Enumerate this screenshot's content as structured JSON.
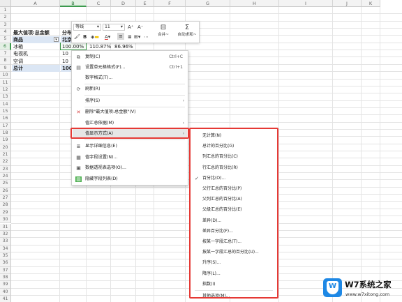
{
  "columns": [
    "A",
    "B",
    "C",
    "D",
    "E",
    "F",
    "G",
    "H",
    "I",
    "J",
    "K"
  ],
  "rows": [
    "1",
    "2",
    "3",
    "4",
    "5",
    "6",
    "7",
    "8",
    "9",
    "10",
    "11",
    "12",
    "13",
    "14",
    "15",
    "16",
    "17",
    "18",
    "19",
    "20",
    "21",
    "22",
    "23",
    "24",
    "25",
    "26",
    "27",
    "28",
    "29",
    "30",
    "31",
    "32",
    "33",
    "34",
    "35",
    "36",
    "37",
    "38",
    "39",
    "40",
    "41"
  ],
  "pivot": {
    "title": "最大值项:总金额",
    "title_right": "分布",
    "row_header": "商品",
    "col_header_partial": "北京",
    "items": [
      {
        "name": "冰箱",
        "b": "100.00%",
        "c": "110.87%",
        "d": "86.96%"
      },
      {
        "name": "电视机",
        "b": "10",
        "c": "",
        "d": ""
      },
      {
        "name": "空调",
        "b": "10",
        "c": "",
        "d": ""
      }
    ],
    "total_label": "总计",
    "total_b": "100"
  },
  "mini_toolbar": {
    "font_name": "等线",
    "font_size": "11",
    "grow_font": "A⁺",
    "shrink_font": "A⁻",
    "merge_label": "合并~",
    "autosum_label": "自动求和~",
    "bold": "B"
  },
  "context_menu": {
    "items": [
      {
        "label": "复制(C)",
        "shortcut": "Ctrl+C",
        "icon": "copy-icon"
      },
      {
        "label": "设置单元格格式(F)...",
        "shortcut": "Ctrl+1",
        "icon": "format-cells-icon"
      },
      {
        "label": "数字格式(T)...",
        "shortcut": "",
        "icon": ""
      },
      {
        "label": "刷新(R)",
        "shortcut": "",
        "icon": "refresh-icon"
      },
      {
        "label": "排序(S)",
        "shortcut": "",
        "icon": ""
      },
      {
        "label": "删除\"最大值项:总金额\"(V)",
        "shortcut": "",
        "icon": "delete-icon"
      },
      {
        "label": "值汇总依据(M)",
        "shortcut": "",
        "icon": ""
      },
      {
        "label": "值显示方式(A)",
        "shortcut": "",
        "icon": ""
      },
      {
        "label": "显示详细信息(E)",
        "shortcut": "",
        "icon": "details-icon"
      },
      {
        "label": "值字段设置(N)...",
        "shortcut": "",
        "icon": "field-settings-icon"
      },
      {
        "label": "数据透视表选项(O)...",
        "shortcut": "",
        "icon": "pivot-options-icon"
      },
      {
        "label": "隐藏字段列表(D)",
        "shortcut": "",
        "icon": "field-list-icon"
      }
    ]
  },
  "submenu": {
    "items": [
      "无计算(N)",
      "总计的百分比(G)",
      "列汇总的百分比(C)",
      "行汇总的百分比(R)",
      "百分比(O)...",
      "父行汇总的百分比(P)",
      "父列汇总的百分比(A)",
      "父级汇总的百分比(E)",
      "差异(D)...",
      "差异百分比(F)...",
      "按某一字段汇总(T)...",
      "按某一字段汇总的百分比(U)...",
      "升序(S)...",
      "降序(L)...",
      "指数(I)",
      "其他选项(M)..."
    ],
    "checked_index": 4
  },
  "watermark": {
    "title": "W7系统之家",
    "url": "www.w7xitong.com",
    "logo_letter": "W"
  },
  "colors": {
    "highlight_red": "#e53935",
    "selection_green": "#3b9a4d",
    "pivot_blue": "#dbe6f4"
  }
}
